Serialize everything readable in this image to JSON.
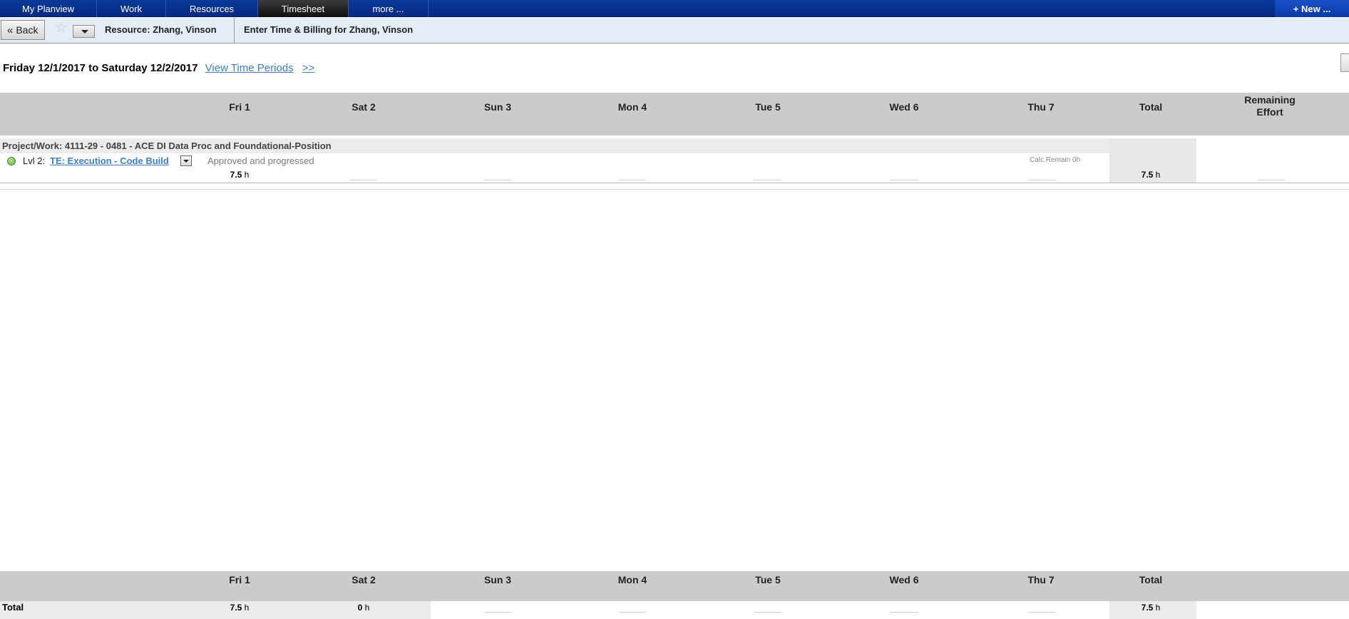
{
  "nav": {
    "tabs": [
      {
        "label": "My Planview"
      },
      {
        "label": "Work"
      },
      {
        "label": "Resources"
      },
      {
        "label": "Timesheet"
      },
      {
        "label": "more ..."
      }
    ],
    "active_tab": "Timesheet",
    "new_label": "+ New ..."
  },
  "subbar": {
    "back_label": "Back",
    "resource_label": "Resource:  Zhang, Vinson",
    "title": "Enter Time & Billing for Zhang, Vinson"
  },
  "period": {
    "text": "Friday 12/1/2017 to Saturday 12/2/2017",
    "view_periods_label": "View Time Periods",
    "next_label": ">>"
  },
  "columns": {
    "days": [
      "Fri 1",
      "Sat 2",
      "Sun 3",
      "Mon 4",
      "Tue 5",
      "Wed 6",
      "Thu 7"
    ],
    "total": "Total",
    "remaining": "Remaining Effort"
  },
  "project": {
    "title": "Project/Work: 4111-29 - 0481 - ACE DI Data Proc and Foundational-Position",
    "task": {
      "level": "Lvl 2:",
      "name": "TE: Execution - Code Build",
      "status": "Approved and progressed",
      "calc_remain": "Calc.Remain 0h",
      "fri_hours": "7.5",
      "total_hours": "7.5",
      "unit": "h"
    }
  },
  "totals": {
    "label": "Total",
    "fri": "7.5",
    "sat": "0",
    "total": "7.5",
    "unit": "h"
  },
  "colors": {
    "nav_bg": "#062a82",
    "header_grey": "#cbcbcb",
    "link": "#3e7fc4",
    "status_green": "#5fae3c"
  },
  "icons": {
    "back": "double-chevron-left-icon",
    "favorite": "star-icon",
    "menu": "chevron-down-icon",
    "status": "green-status-dot-icon"
  }
}
